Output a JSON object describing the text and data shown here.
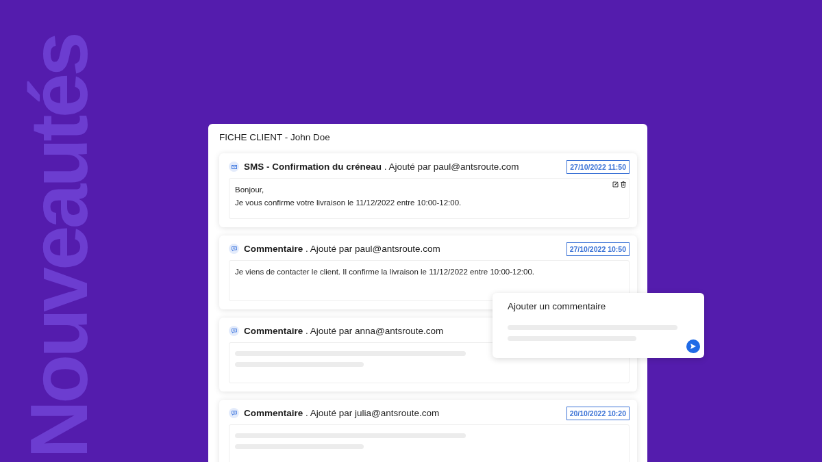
{
  "banner": {
    "text": "Nouveautés"
  },
  "window": {
    "title": "FICHE CLIENT - John Doe"
  },
  "entries": [
    {
      "kind": "sms",
      "title": "SMS - Confirmation du créneau",
      "author": ". Ajouté par paul@antsroute.com",
      "date": "27/10/2022 11:50",
      "actions": true,
      "body": [
        "Bonjour,",
        "Je vous confirme votre livraison le 11/12/2022 entre 10:00-12:00."
      ]
    },
    {
      "kind": "comment",
      "title": "Commentaire",
      "author": ". Ajouté par paul@antsroute.com",
      "date": "27/10/2022 10:50",
      "actions": false,
      "body": [
        "Je viens de contacter le client. Il confirme la livraison le 11/12/2022 entre 10:00-12:00."
      ]
    },
    {
      "kind": "comment",
      "title": "Commentaire",
      "author": ". Ajouté par anna@antsroute.com"
    },
    {
      "kind": "comment",
      "title": "Commentaire",
      "author": ". Ajouté par julia@antsroute.com",
      "date": "20/10/2022 10:20",
      "actions": false
    }
  ],
  "popup": {
    "title": "Ajouter un commentaire"
  }
}
